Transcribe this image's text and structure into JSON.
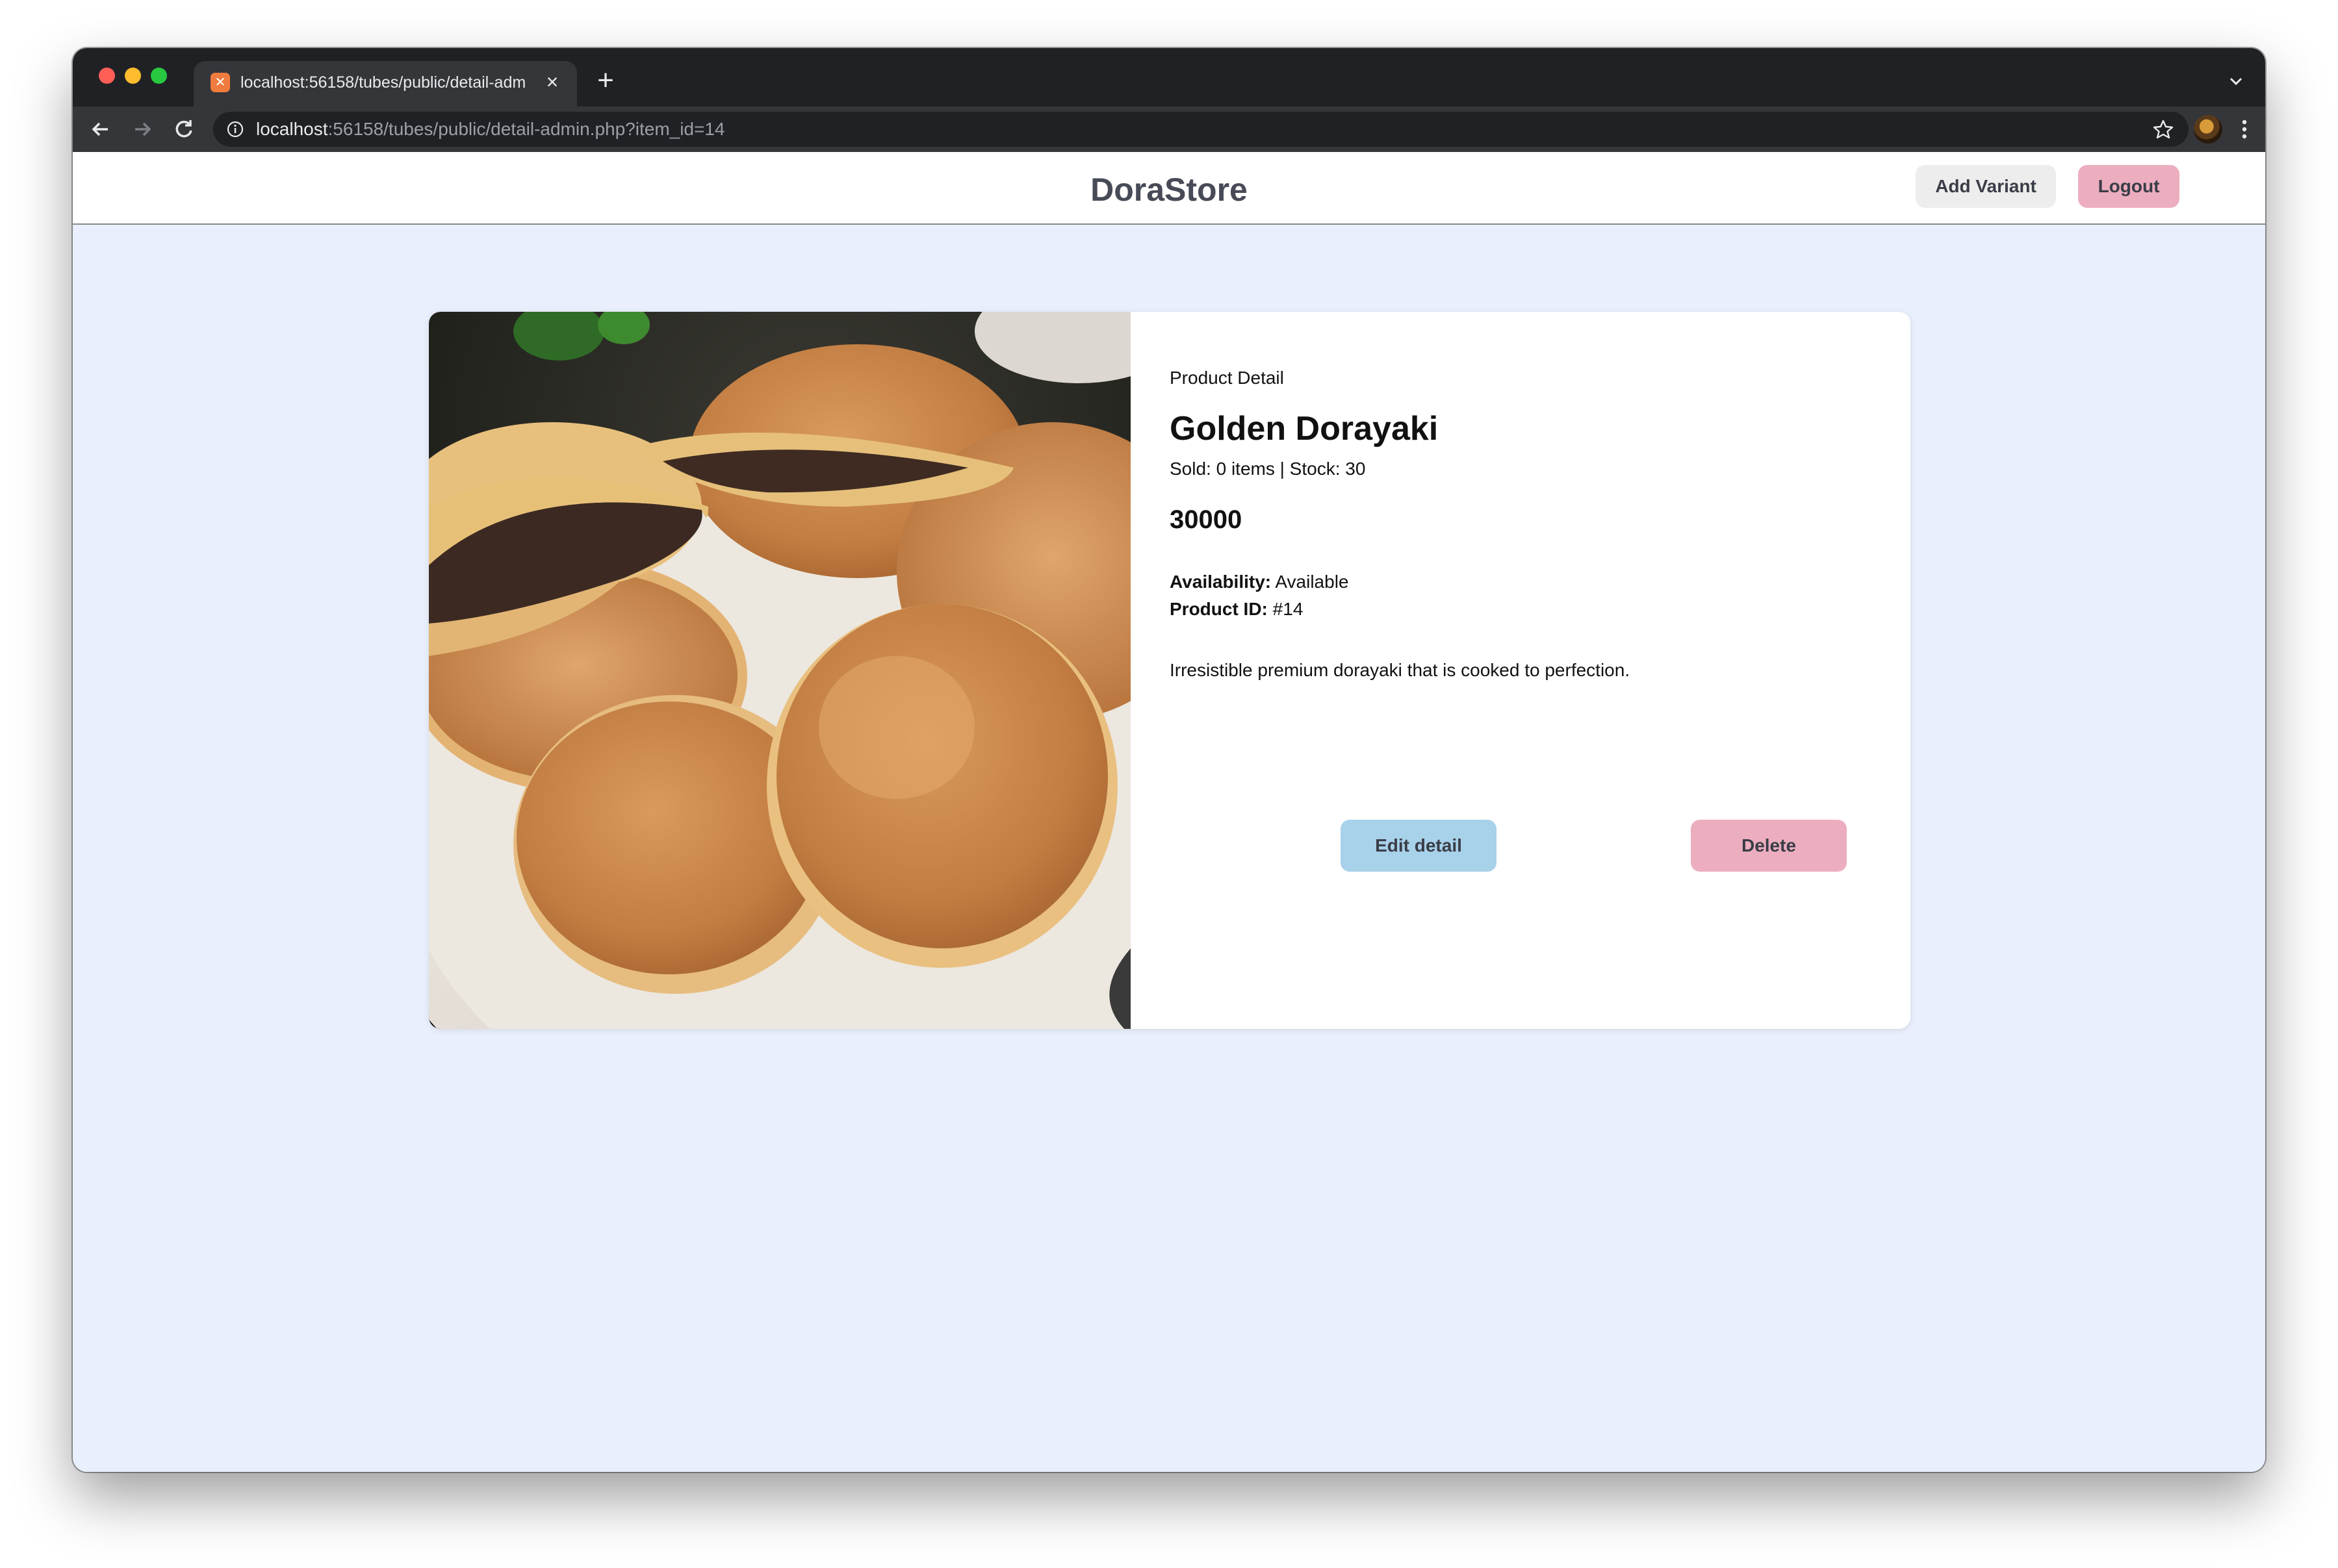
{
  "browser": {
    "tab_title": "localhost:56158/tubes/public/detail-admin.php?item_id=14",
    "tab_favicon": "xampp-icon",
    "url_host": "localhost",
    "url_path": ":56158/tubes/public/detail-admin.php?item_id=14"
  },
  "header": {
    "brand": "DoraStore",
    "add_variant_label": "Add Variant",
    "logout_label": "Logout"
  },
  "product": {
    "section_label": "Product Detail",
    "name": "Golden Dorayaki",
    "sold_stock": "Sold: 0 items | Stock: 30",
    "price": "30000",
    "availability_label": "Availability:",
    "availability_value": "Available",
    "product_id_label": "Product ID:",
    "product_id_value": "#14",
    "description": "Irresistible premium dorayaki that is cooked to perfection.",
    "edit_label": "Edit detail",
    "delete_label": "Delete"
  },
  "colors": {
    "page_background": "#e9effc",
    "edit_button": "#a8d1ea",
    "delete_button": "#ecaebf",
    "logout_button": "#ecaebf",
    "add_variant_button": "#ededed"
  }
}
